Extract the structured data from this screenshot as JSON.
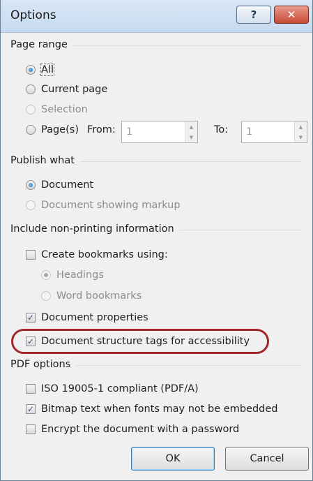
{
  "window": {
    "title": "Options",
    "help_label": "?",
    "close_label": "✕"
  },
  "page_range": {
    "heading": "Page range",
    "all": "All",
    "current": "Current page",
    "selection": "Selection",
    "pages": "Page(s)",
    "from_label": "From:",
    "from_value": "1",
    "to_label": "To:",
    "to_value": "1"
  },
  "publish_what": {
    "heading": "Publish what",
    "document": "Document",
    "markup": "Document showing markup"
  },
  "non_printing": {
    "heading": "Include non-printing information",
    "bookmarks": "Create bookmarks using:",
    "headings": "Headings",
    "word_bookmarks": "Word bookmarks",
    "properties": "Document properties",
    "structure_tags": "Document structure tags for accessibility"
  },
  "pdf_options": {
    "heading": "PDF options",
    "iso": "ISO 19005-1 compliant (PDF/A)",
    "bitmap": "Bitmap text when fonts may not be embedded",
    "encrypt": "Encrypt the document with a password"
  },
  "buttons": {
    "ok": "OK",
    "cancel": "Cancel"
  },
  "icons": {
    "checkmark": "✓",
    "spin_up": "▲",
    "spin_down": "▼"
  },
  "colors": {
    "highlight_ring": "#a3262a",
    "radio_selected": "#1665b3"
  }
}
